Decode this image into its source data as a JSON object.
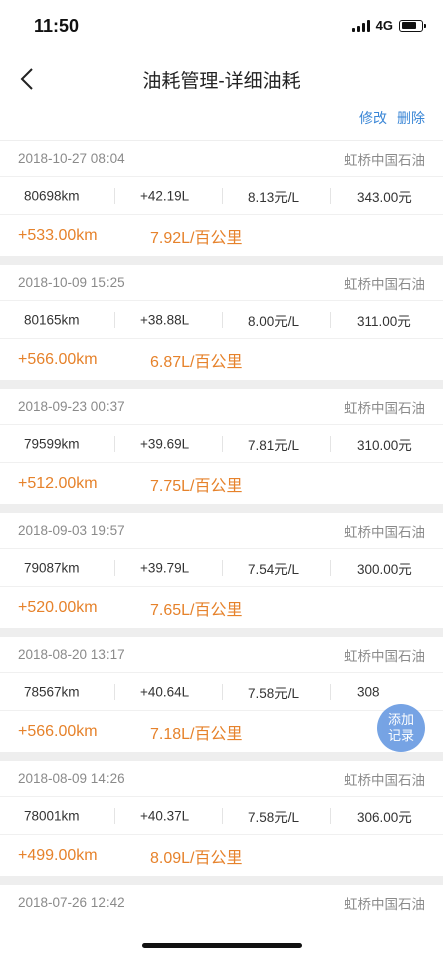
{
  "status": {
    "time": "11:50",
    "network": "4G",
    "battery_level": 0.75
  },
  "nav": {
    "title": "油耗管理-详细油耗",
    "back_icon": "chevron-left-icon"
  },
  "actions": {
    "edit": "修改",
    "delete": "删除"
  },
  "records": [
    {
      "date": "2018-10-27 08:04",
      "station": "虹桥中国石油",
      "odometer": "80698km",
      "fuel": "+42.19L",
      "price": "8.13元/L",
      "amount": "343.00元",
      "distance": "+533.00km",
      "consumption": "7.92L/百公里"
    },
    {
      "date": "2018-10-09 15:25",
      "station": "虹桥中国石油",
      "odometer": "80165km",
      "fuel": "+38.88L",
      "price": "8.00元/L",
      "amount": "311.00元",
      "distance": "+566.00km",
      "consumption": "6.87L/百公里"
    },
    {
      "date": "2018-09-23 00:37",
      "station": "虹桥中国石油",
      "odometer": "79599km",
      "fuel": "+39.69L",
      "price": "7.81元/L",
      "amount": "310.00元",
      "distance": "+512.00km",
      "consumption": "7.75L/百公里"
    },
    {
      "date": "2018-09-03 19:57",
      "station": "虹桥中国石油",
      "odometer": "79087km",
      "fuel": "+39.79L",
      "price": "7.54元/L",
      "amount": "300.00元",
      "distance": "+520.00km",
      "consumption": "7.65L/百公里"
    },
    {
      "date": "2018-08-20 13:17",
      "station": "虹桥中国石油",
      "odometer": "78567km",
      "fuel": "+40.64L",
      "price": "7.58元/L",
      "amount": "308",
      "distance": "+566.00km",
      "consumption": "7.18L/百公里"
    },
    {
      "date": "2018-08-09 14:26",
      "station": "虹桥中国石油",
      "odometer": "78001km",
      "fuel": "+40.37L",
      "price": "7.58元/L",
      "amount": "306.00元",
      "distance": "+499.00km",
      "consumption": "8.09L/百公里"
    },
    {
      "date": "2018-07-26 12:42",
      "station": "虹桥中国石油"
    }
  ],
  "fab": {
    "line1": "添加",
    "line2": "记录"
  },
  "colors": {
    "accent": "#e6822b",
    "link": "#3a86d6",
    "fab": "#6f9fe3"
  }
}
